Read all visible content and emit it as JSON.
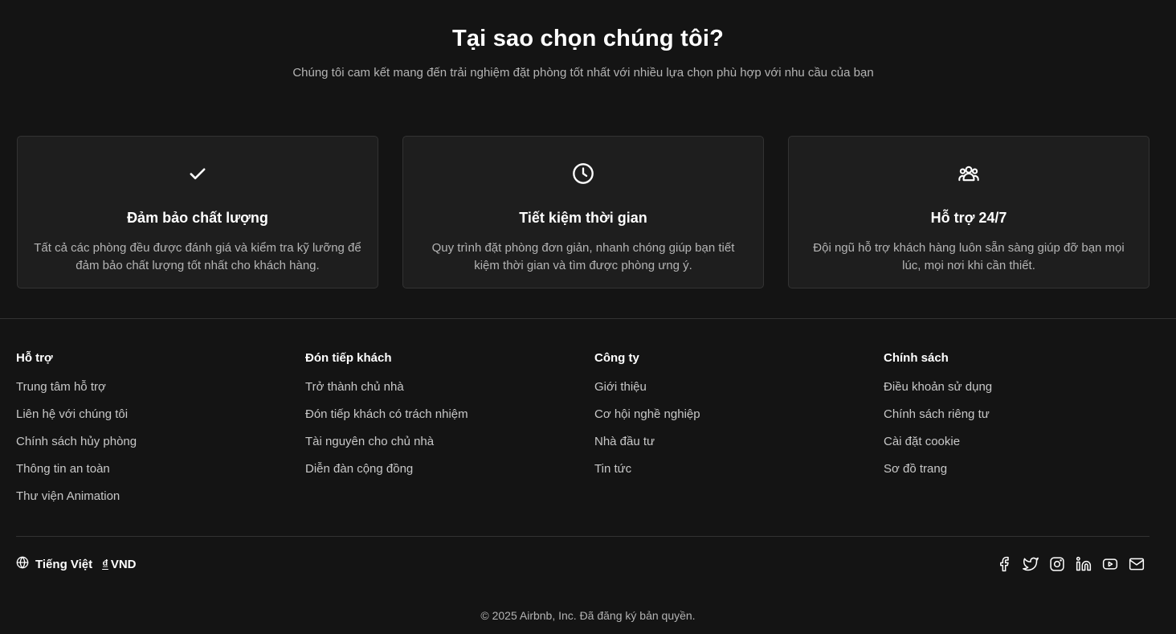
{
  "why": {
    "title": "Tại sao chọn chúng tôi?",
    "subtitle": "Chúng tôi cam kết mang đến trải nghiệm đặt phòng tốt nhất với nhiều lựa chọn phù hợp với nhu cầu của bạn",
    "cards": [
      {
        "icon": "check-icon",
        "title": "Đảm bảo chất lượng",
        "text": "Tất cả các phòng đều được đánh giá và kiểm tra kỹ lưỡng để đảm bảo chất lượng tốt nhất cho khách hàng."
      },
      {
        "icon": "clock-icon",
        "title": "Tiết kiệm thời gian",
        "text": "Quy trình đặt phòng đơn giản, nhanh chóng giúp bạn tiết kiệm thời gian và tìm được phòng ưng ý."
      },
      {
        "icon": "users-icon",
        "title": "Hỗ trợ 24/7",
        "text": "Đội ngũ hỗ trợ khách hàng luôn sẵn sàng giúp đỡ bạn mọi lúc, mọi nơi khi cần thiết."
      }
    ]
  },
  "footer": {
    "columns": [
      {
        "title": "Hỗ trợ",
        "links": [
          "Trung tâm hỗ trợ",
          "Liên hệ với chúng tôi",
          "Chính sách hủy phòng",
          "Thông tin an toàn",
          "Thư viện Animation"
        ]
      },
      {
        "title": "Đón tiếp khách",
        "links": [
          "Trở thành chủ nhà",
          "Đón tiếp khách có trách nhiệm",
          "Tài nguyên cho chủ nhà",
          "Diễn đàn cộng đồng"
        ]
      },
      {
        "title": "Công ty",
        "links": [
          "Giới thiệu",
          "Cơ hội nghề nghiệp",
          "Nhà đầu tư",
          "Tin tức"
        ]
      },
      {
        "title": "Chính sách",
        "links": [
          "Điều khoản sử dụng",
          "Chính sách riêng tư",
          "Cài đặt cookie",
          "Sơ đồ trang"
        ]
      }
    ],
    "language": "Tiếng Việt",
    "currency_symbol": "₫",
    "currency": "VND",
    "social_icons": [
      "facebook-icon",
      "twitter-icon",
      "instagram-icon",
      "linkedin-icon",
      "youtube-icon",
      "mail-icon"
    ],
    "copyright": "© 2025 Airbnb, Inc. Đã đăng ký bản quyền."
  },
  "colors": {
    "background": "#141414",
    "card_background": "#1e1e1e",
    "border": "#333333",
    "muted_text": "#b4b4b4",
    "link_text": "#c8c8c8"
  }
}
